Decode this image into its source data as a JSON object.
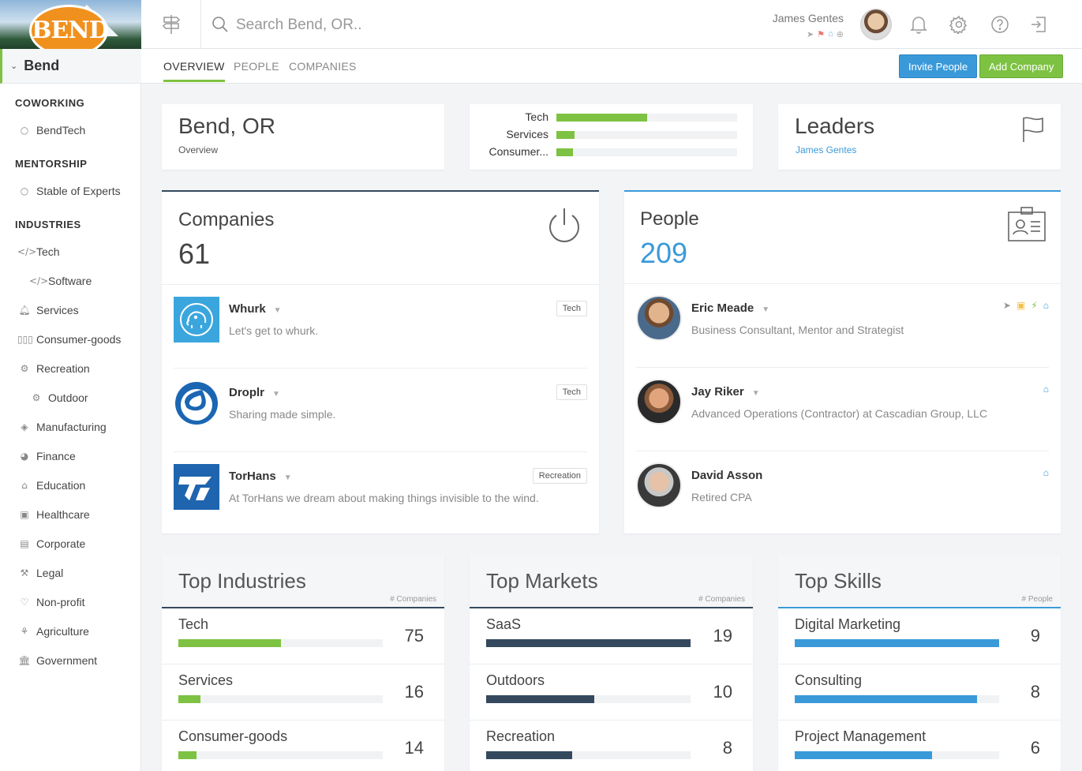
{
  "sidebar": {
    "logo_text": "BEND",
    "city": "Bend",
    "sections": [
      {
        "title": "COWORKING",
        "items": [
          {
            "label": "BendTech",
            "icon": "circle-icon"
          }
        ]
      },
      {
        "title": "MENTORSHIP",
        "items": [
          {
            "label": "Stable of Experts",
            "icon": "circle-icon"
          }
        ]
      },
      {
        "title": "INDUSTRIES",
        "items": [
          {
            "label": "Tech",
            "icon": "code-icon"
          },
          {
            "label": "Software",
            "icon": "code-icon",
            "sub": true
          },
          {
            "label": "Services",
            "icon": "bell-icon"
          },
          {
            "label": "Consumer-goods",
            "icon": "barcode-icon"
          },
          {
            "label": "Recreation",
            "icon": "gear-icon"
          },
          {
            "label": "Outdoor",
            "icon": "gear-icon",
            "sub": true
          },
          {
            "label": "Manufacturing",
            "icon": "cube-icon"
          },
          {
            "label": "Finance",
            "icon": "pie-chart-icon"
          },
          {
            "label": "Education",
            "icon": "graduation-cap-icon"
          },
          {
            "label": "Healthcare",
            "icon": "ambulance-icon"
          },
          {
            "label": "Corporate",
            "icon": "building-icon"
          },
          {
            "label": "Legal",
            "icon": "gavel-icon"
          },
          {
            "label": "Non-profit",
            "icon": "heart-icon"
          },
          {
            "label": "Agriculture",
            "icon": "plant-icon"
          },
          {
            "label": "Government",
            "icon": "institution-icon"
          }
        ]
      }
    ]
  },
  "topbar": {
    "search_placeholder": "Search Bend, OR..",
    "user_name": "James Gentes"
  },
  "tabs": [
    "OVERVIEW",
    "PEOPLE",
    "COMPANIES"
  ],
  "actions": {
    "invite": "Invite People",
    "add_company": "Add Company"
  },
  "overview": {
    "title": "Bend, OR",
    "subtitle": "Overview"
  },
  "industry_mini": [
    {
      "label": "Tech",
      "fraction": 0.5
    },
    {
      "label": "Services",
      "fraction": 0.1
    },
    {
      "label": "Consumer...",
      "fraction": 0.09
    }
  ],
  "leaders": {
    "title": "Leaders",
    "name": "James Gentes"
  },
  "companies": {
    "title": "Companies",
    "count": "61",
    "items": [
      {
        "name": "Whurk",
        "desc": "Let's get to whurk.",
        "tag": "Tech"
      },
      {
        "name": "Droplr",
        "desc": "Sharing made simple.",
        "tag": "Tech"
      },
      {
        "name": "TorHans",
        "desc": "At TorHans we dream about making things invisible to the wind.",
        "tag": "Recreation"
      }
    ]
  },
  "people": {
    "title": "People",
    "count": "209",
    "items": [
      {
        "name": "Eric Meade",
        "desc": "Business Consultant, Mentor and Strategist"
      },
      {
        "name": "Jay Riker",
        "desc": "Advanced Operations (Contractor) at Cascadian Group, LLC"
      },
      {
        "name": "David Asson",
        "desc": "Retired CPA"
      }
    ]
  },
  "colors": {
    "green": "#7dc242",
    "blue": "#3a9ad9",
    "navy": "#34495e"
  },
  "top_industries": {
    "title": "Top Industries",
    "unit": "# Companies",
    "rows": [
      {
        "label": "Tech",
        "value": "75",
        "fraction": 0.5
      },
      {
        "label": "Services",
        "value": "16",
        "fraction": 0.11
      },
      {
        "label": "Consumer-goods",
        "value": "14",
        "fraction": 0.09
      }
    ]
  },
  "top_markets": {
    "title": "Top Markets",
    "unit": "# Companies",
    "rows": [
      {
        "label": "SaaS",
        "value": "19",
        "fraction": 1.0
      },
      {
        "label": "Outdoors",
        "value": "10",
        "fraction": 0.53
      },
      {
        "label": "Recreation",
        "value": "8",
        "fraction": 0.42
      }
    ]
  },
  "top_skills": {
    "title": "Top Skills",
    "unit": "# People",
    "rows": [
      {
        "label": "Digital Marketing",
        "value": "9",
        "fraction": 1.0
      },
      {
        "label": "Consulting",
        "value": "8",
        "fraction": 0.89
      },
      {
        "label": "Project Management",
        "value": "6",
        "fraction": 0.67
      }
    ]
  }
}
